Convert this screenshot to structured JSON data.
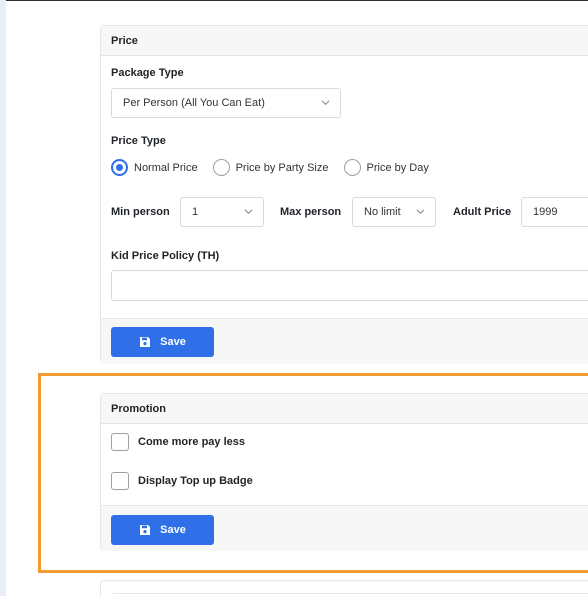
{
  "price": {
    "header": "Price",
    "package_type_label": "Package Type",
    "package_type_value": "Per Person (All You Can Eat)",
    "price_type_label": "Price Type",
    "price_type_options": [
      "Normal Price",
      "Price by Party Size",
      "Price by Day"
    ],
    "price_type_selected": "Normal Price",
    "min_person_label": "Min person",
    "min_person_value": "1",
    "max_person_label": "Max person",
    "max_person_value": "No limit",
    "adult_price_label": "Adult Price",
    "adult_price_value": "1999",
    "kid_policy_label": "Kid Price Policy (TH)",
    "kid_policy_value": "",
    "save_label": "Save"
  },
  "promotion": {
    "header": "Promotion",
    "checkboxes": [
      {
        "label": "Come more pay less",
        "checked": false
      },
      {
        "label": "Display Top up Badge",
        "checked": false
      }
    ],
    "save_label": "Save"
  },
  "colors": {
    "accent": "#2f6fe8",
    "highlight": "#f29b30"
  }
}
